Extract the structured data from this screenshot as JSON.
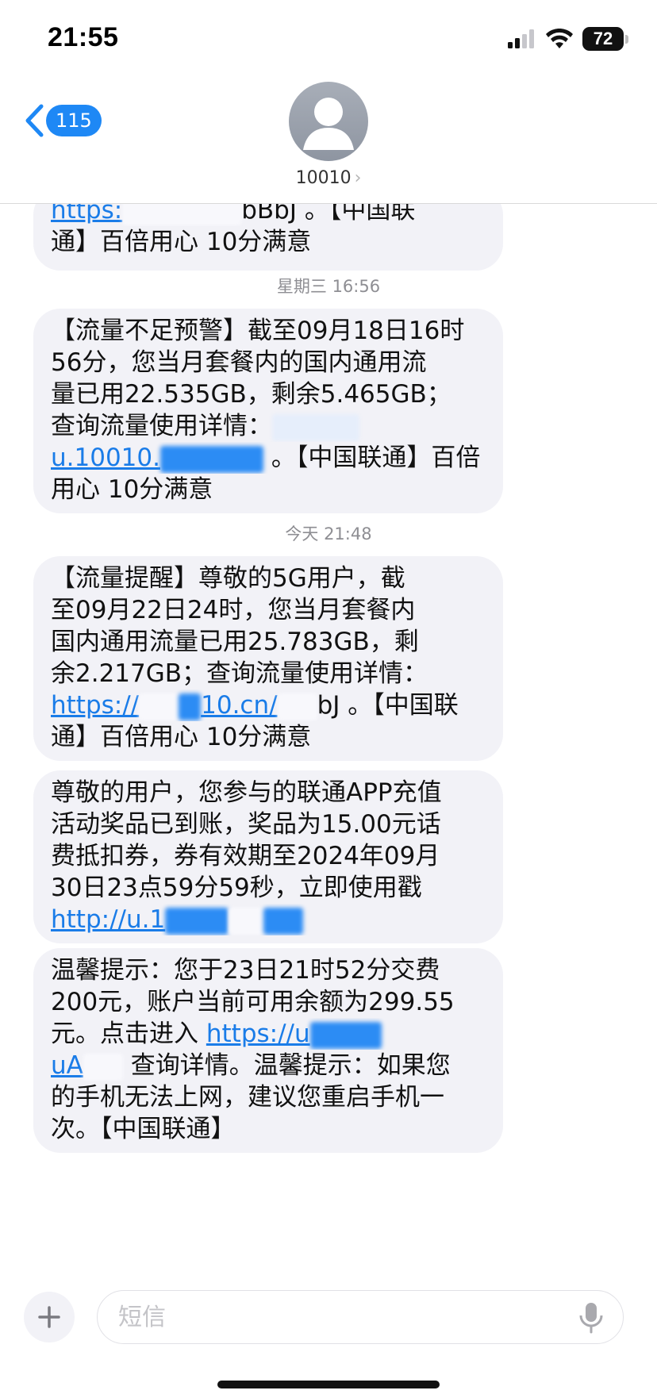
{
  "status_bar": {
    "time": "21:55",
    "battery": "72"
  },
  "header": {
    "back_count": "115",
    "contact": "10010"
  },
  "messages": [
    {
      "lines": [
        {
          "link": "https:",
          "after_link": "bBbJ 。【中国联"
        },
        {
          "text": "通】百倍用心 10分满意"
        }
      ]
    },
    {
      "timestamp": "星期三 16:56"
    },
    {
      "lines": [
        {
          "text": "【流量不足预警】截至09月18日16时"
        },
        {
          "text": " 56分，您当月套餐内的国内通用流"
        },
        {
          "text": "量已用22.535GB，剩余5.465GB；"
        },
        {
          "text": " 查询流量使用详情："
        },
        {
          "link": "u.10010.",
          "after_link": " 。【中国联通】百倍"
        },
        {
          "text": "用心 10分满意"
        }
      ]
    },
    {
      "timestamp": "今天 21:48"
    },
    {
      "lines": [
        {
          "text": "【流量提醒】尊敬的5G用户，截"
        },
        {
          "text": "至09月22日24时，您当月套餐内"
        },
        {
          "text": "国内通用流量已用25.783GB，剩"
        },
        {
          "text": "余2.217GB；查询流量使用详情："
        },
        {
          "link": "https://",
          "link2": "10.cn/",
          "after_link": "bJ 。【中国联"
        },
        {
          "text": "通】百倍用心 10分满意"
        }
      ]
    },
    {
      "lines": [
        {
          "text": "尊敬的用户，您参与的联通APP充值"
        },
        {
          "text": "活动奖品已到账，奖品为15.00元话"
        },
        {
          "text": "费抵扣券，券有效期至2024年09月"
        },
        {
          "text": "30日23点59分59秒，立即使用戳"
        },
        {
          "link": " http://u.1"
        }
      ]
    },
    {
      "lines": [
        {
          "text": "温馨提示：您于23日21时52分交费"
        },
        {
          "text": " 200元，账户当前可用余额为299.55"
        },
        {
          "before_link": "元。点击进入 ",
          "link": "https://u"
        },
        {
          "link": "uA",
          "after_link": "  查询详情。温馨提示：如果您"
        },
        {
          "text": "的手机无法上网，建议您重启手机一"
        },
        {
          "text": "次。【中国联通】"
        }
      ]
    }
  ],
  "input": {
    "placeholder": "短信"
  },
  "icons": {
    "back": "chevron-left-icon",
    "plus": "plus-icon",
    "mic": "microphone-icon",
    "signal": "cellular-signal-icon",
    "wifi": "wifi-icon",
    "battery": "battery-icon",
    "avatar": "person-icon"
  },
  "colors": {
    "accent": "#1e88f5",
    "link": "#1a7ce8",
    "bubble": "#f2f2f7",
    "timestamp": "#8e8e93"
  }
}
